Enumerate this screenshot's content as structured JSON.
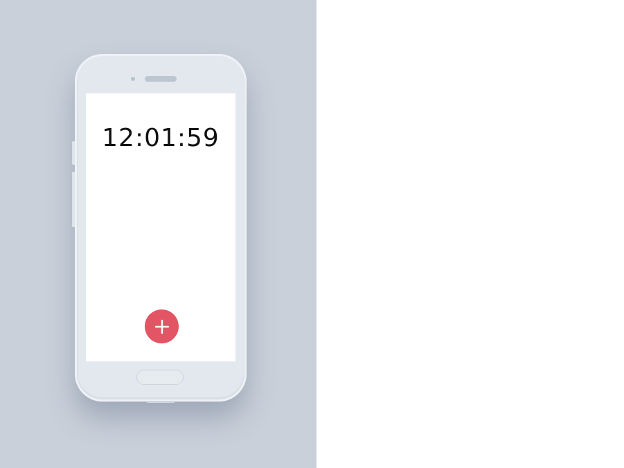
{
  "screen": {
    "clock_text": "12:01:59"
  },
  "fab": {
    "icon": "plus-icon",
    "color": "#e35464"
  },
  "colors": {
    "backdrop": "#c9d0da",
    "phone_body": "#e3e8ee",
    "screen": "#ffffff"
  }
}
